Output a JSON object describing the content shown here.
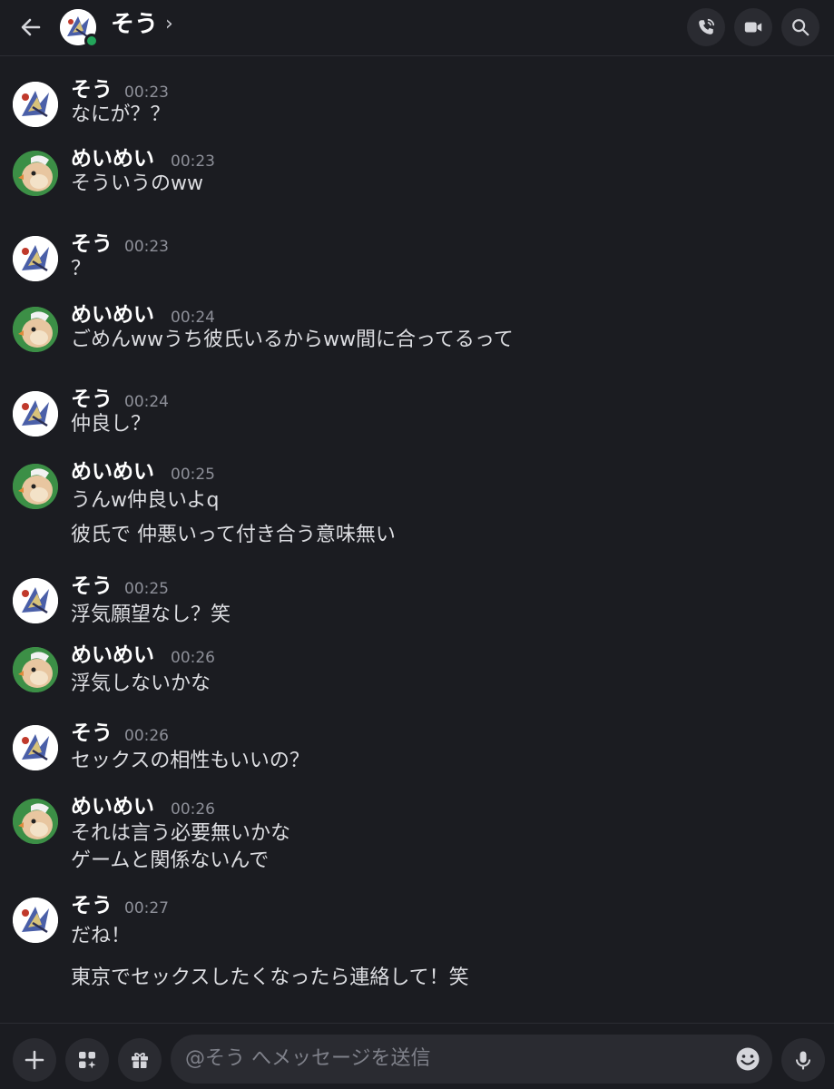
{
  "header": {
    "title": "そう",
    "chevron": "›",
    "status": "online",
    "icons": [
      "back-arrow-icon",
      "phone-icon",
      "video-camera-icon",
      "search-icon"
    ],
    "status_color": "#23a55a"
  },
  "messages": [
    {
      "author": "そう",
      "time": "00:23",
      "lines": [
        "なにが？？"
      ]
    },
    {
      "author": "めいめい",
      "time": "00:23",
      "lines": [
        "そういうのww"
      ]
    },
    {
      "author": "そう",
      "time": "00:23",
      "lines": [
        "？"
      ]
    },
    {
      "author": "めいめい",
      "time": "00:24",
      "lines": [
        "ごめんwwうち彼氏いるからww間に合ってるって"
      ]
    },
    {
      "author": "そう",
      "time": "00:24",
      "lines": [
        "仲良し？"
      ]
    },
    {
      "author": "めいめい",
      "time": "00:25",
      "lines": [
        "うんw仲良いよq",
        "彼氏で 仲悪いって付き合う意味無い"
      ]
    },
    {
      "author": "そう",
      "time": "00:25",
      "lines": [
        "浮気願望なし？笑"
      ]
    },
    {
      "author": "めいめい",
      "time": "00:26",
      "lines": [
        "浮気しないかな"
      ]
    },
    {
      "author": "そう",
      "time": "00:26",
      "lines": [
        "セックスの相性もいいの？"
      ]
    },
    {
      "author": "めいめい",
      "time": "00:26",
      "lines": [
        "それは言う必要無いかな",
        "ゲームと関係ないんで"
      ]
    },
    {
      "author": "そう",
      "time": "00:27",
      "lines": [
        "だね！",
        "東京でセックスしたくなったら連絡して！笑"
      ]
    }
  ],
  "composer": {
    "placeholder": "@そう へメッセージを送信",
    "icons": [
      "plus-icon",
      "apps-icon",
      "gift-icon",
      "emoji-icon",
      "microphone-icon"
    ]
  }
}
